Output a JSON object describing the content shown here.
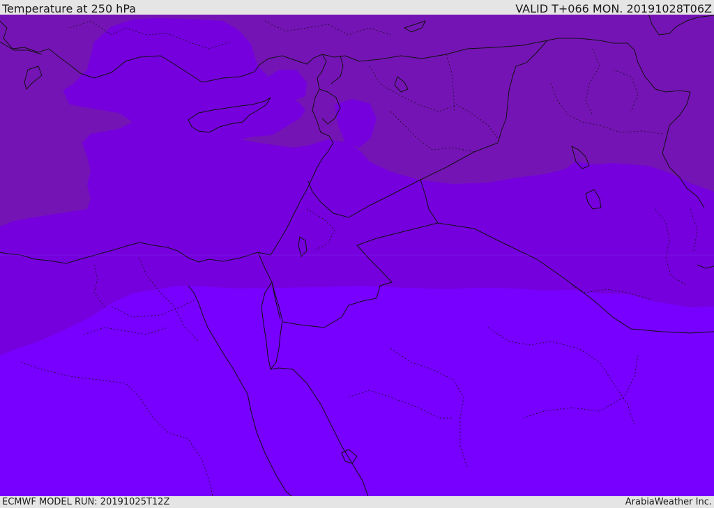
{
  "header": {
    "title": "Temperature at 250 hPa",
    "valid": "VALID T+066 MON. 20191028T06Z"
  },
  "footer": {
    "model_run": "ECMWF MODEL RUN: 20191025T12Z",
    "credit": "ArabiaWeather Inc."
  },
  "colors": {
    "band_cold": "#7514b5",
    "band_mid": "#7500dd",
    "band_warm": "#7700ff",
    "borders": "#111111",
    "frame": "#e5e5e5"
  },
  "map": {
    "field": "Temperature",
    "level": "250 hPa"
  }
}
